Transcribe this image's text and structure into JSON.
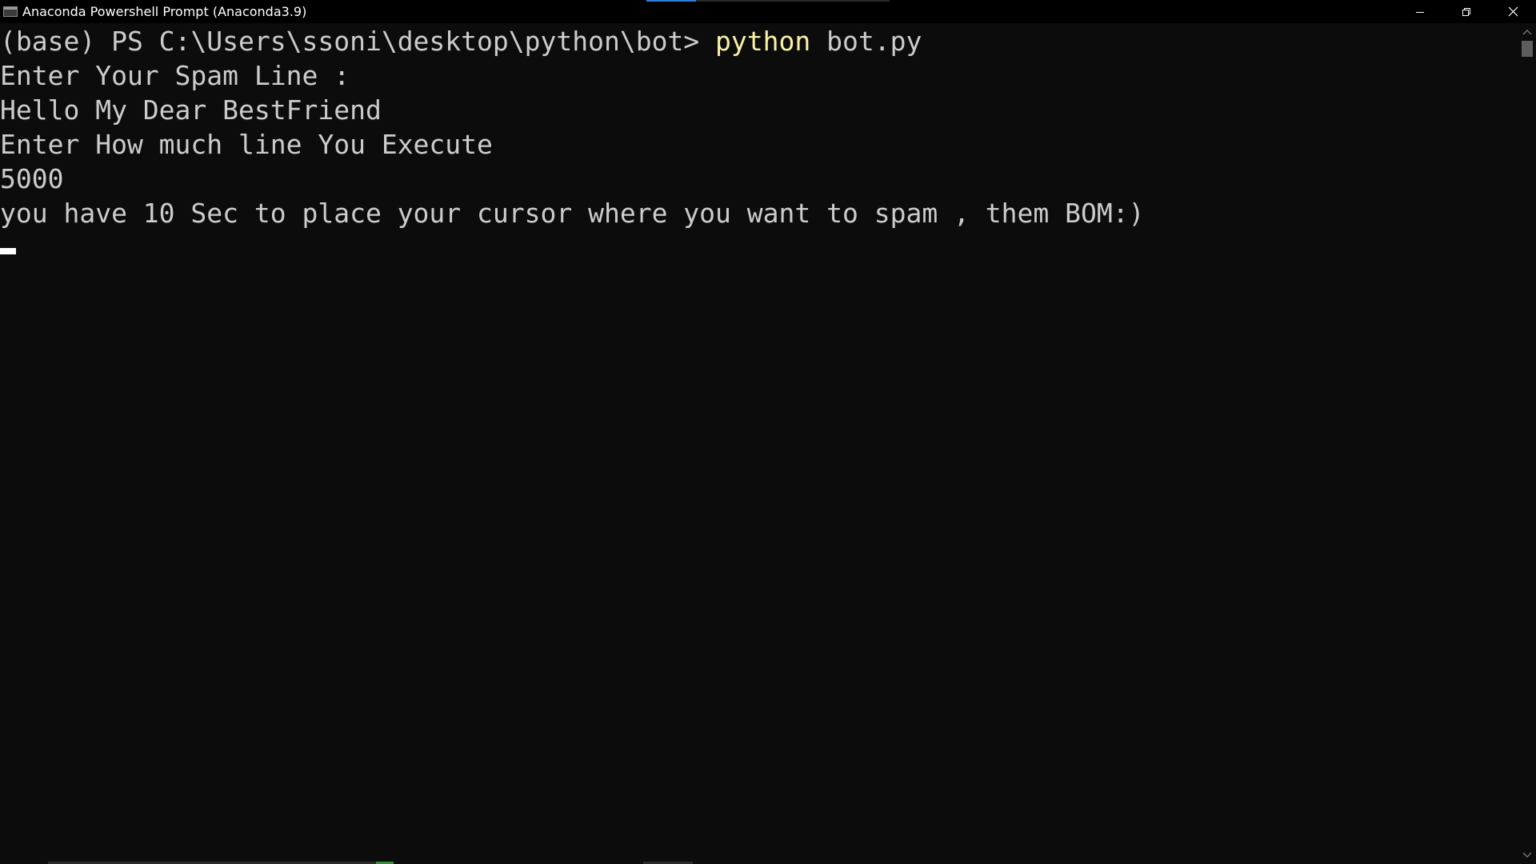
{
  "window": {
    "title": "Anaconda Powershell Prompt (Anaconda3.9)",
    "controls": {
      "minimize_icon": "minimize-icon",
      "restore_icon": "restore-icon",
      "close_icon": "close-icon"
    }
  },
  "terminal": {
    "prompt": "(base) PS C:\\Users\\ssoni\\desktop\\python\\bot> ",
    "command": "python",
    "command_args": " bot.py",
    "lines": [
      "Enter Your Spam Line :",
      "Hello My Dear BestFriend",
      "Enter How much line You Execute",
      "5000",
      "you have 10 Sec to place your cursor where you want to spam , them BOM:)"
    ]
  },
  "colors": {
    "background": "#0c0c0c",
    "text": "#cccccc",
    "command": "#f9f1a5",
    "titlebar": "#000000"
  }
}
